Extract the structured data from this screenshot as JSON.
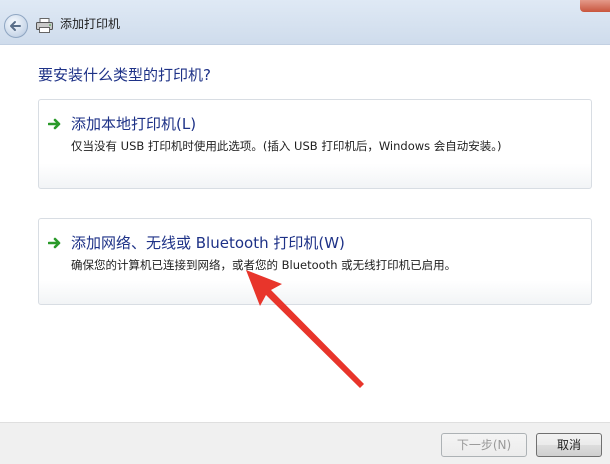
{
  "window": {
    "title": "添加打印机",
    "icons": {
      "back": "back-arrow-icon",
      "app": "printer-icon"
    }
  },
  "main": {
    "question": "要安装什么类型的打印机?",
    "options": [
      {
        "title": "添加本地打印机(L)",
        "description": "仅当没有 USB 打印机时使用此选项。(插入 USB 打印机后，Windows 会自动安装。)",
        "icon": "green-arrow-icon"
      },
      {
        "title": "添加网络、无线或 Bluetooth 打印机(W)",
        "description": "确保您的计算机已连接到网络，或者您的 Bluetooth 或无线打印机已启用。",
        "icon": "green-arrow-icon"
      }
    ]
  },
  "footer": {
    "next_label": "下一步(N)",
    "cancel_label": "取消",
    "next_enabled": false
  },
  "colors": {
    "heading": "#1e3287",
    "arrow_green": "#2a9a2a",
    "annotation_red": "#e8352b"
  }
}
